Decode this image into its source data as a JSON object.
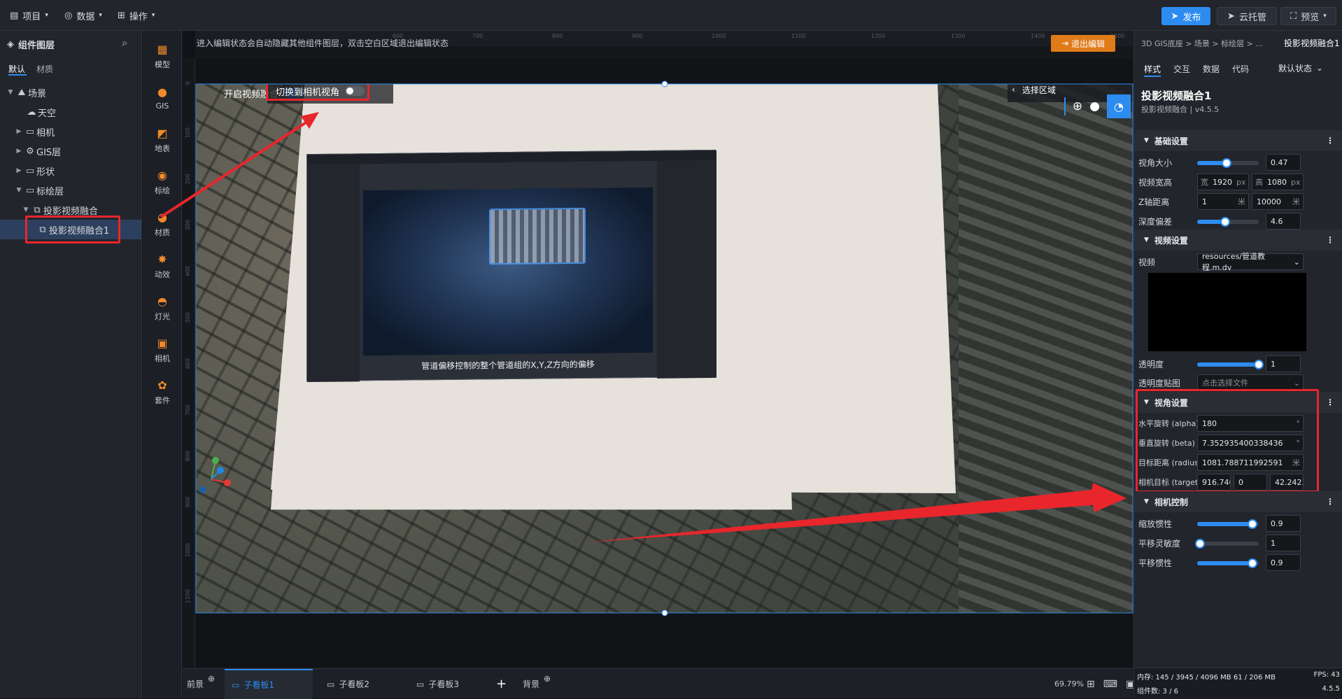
{
  "topbar": {
    "menus": [
      {
        "label": "项目"
      },
      {
        "label": "数据"
      },
      {
        "label": "操作"
      }
    ],
    "publish_label": "发布",
    "cloud_label": "云托管",
    "preview_label": "预览"
  },
  "left_panel": {
    "title": "组件图层",
    "tabs": [
      "默认",
      "材质"
    ],
    "tree": [
      {
        "label": "场景"
      },
      {
        "label": "天空"
      },
      {
        "label": "相机"
      },
      {
        "label": "GIS层"
      },
      {
        "label": "形状"
      },
      {
        "label": "标绘层"
      },
      {
        "label": "投影视频融合"
      },
      {
        "label": "投影视频融合1"
      }
    ]
  },
  "tools": [
    {
      "label": "模型"
    },
    {
      "label": "GIS"
    },
    {
      "label": "地表"
    },
    {
      "label": "标绘"
    },
    {
      "label": "材质"
    },
    {
      "label": "动效"
    },
    {
      "label": "灯光"
    },
    {
      "label": "相机"
    },
    {
      "label": "套件"
    }
  ],
  "canvas": {
    "hint": "进入编辑状态会自动隐藏其他组件图层，双击空白区域退出编辑状态",
    "exit_edit_label": "退出编辑",
    "ruler_h": [
      "600",
      "700",
      "800",
      "900",
      "1000",
      "1100",
      "1200",
      "1300",
      "1400",
      "1500",
      "1600",
      "1700"
    ],
    "ruler_v": [
      "0",
      "100",
      "200",
      "300",
      "400",
      "500",
      "600",
      "700",
      "800",
      "900",
      "1000",
      "1100"
    ],
    "toggle_video_label": "开启视频融合",
    "toggle_camera_label": "切换到相机视角",
    "select_area_label": "选择区域",
    "video_caption": "管道偏移控制的整个管道组的X,Y,Z方向的偏移"
  },
  "right_panel": {
    "breadcrumb": "3D GIS底座 > 场景 > 标绘层 > ...",
    "component_title": "投影视频融合1",
    "tabs": [
      "样式",
      "交互",
      "数据",
      "代码"
    ],
    "state_label": "默认状态",
    "name": "投影视频融合1",
    "subname": "投影视频融合 | v4.5.5",
    "sections": {
      "basic": "基础设置",
      "video": "视频设置",
      "view": "视角设置",
      "camera": "相机控制"
    },
    "basic": {
      "fov_label": "视角大小",
      "fov_value": "0.47",
      "fov_level": 0.48,
      "size_label": "视频宽高",
      "width_prefix": "宽",
      "width": "1920",
      "height_prefix": "高",
      "height": "1080",
      "unit": "px",
      "z_label": "Z轴距离",
      "z_near": "1",
      "z_far": "10000",
      "z_unit": "米",
      "depth_label": "深度偏差",
      "depth_value": "4.6",
      "depth_level": 0.46
    },
    "video": {
      "video_label": "视频",
      "video_value": "resources/管道教程.m.dv",
      "opacity_label": "透明度",
      "opacity_value": "1",
      "opacity_level": 1.0,
      "opacity_map_label": "透明度贴图",
      "opacity_map_value": "点击选择文件"
    },
    "view": {
      "alpha_label": "水平旋转 (alpha)",
      "alpha_value": "180",
      "alpha_unit": "°",
      "beta_label": "垂直旋转 (beta)",
      "beta_value": "7.352935400338436",
      "beta_unit": "°",
      "radius_label": "目标距离 (radius)",
      "radius_value": "1081.788711992591",
      "radius_unit": "米",
      "target_label": "相机目标 (target)",
      "target_x": "916.74620",
      "target_y": "0",
      "target_z": "42.242345"
    },
    "camera": {
      "zoom_label": "缩放惯性",
      "zoom_value": "0.9",
      "zoom_level": 0.9,
      "pan_sens_label": "平移灵敏度",
      "pan_sens_value": "1",
      "pan_sens_level": 0.05,
      "pan_inertia_label": "平移惯性",
      "pan_inertia_value": "0.9",
      "pan_inertia_level": 0.9
    },
    "footer": {
      "memory": "内存: 145 / 3945 / 4096 MB  61 / 206 MB",
      "fps": "FPS: 43",
      "count": "组件数: 3 / 6",
      "version": "4.5.5"
    }
  },
  "bottom": {
    "front_label": "前景",
    "tabs": [
      "子看板1",
      "子看板2",
      "子看板3"
    ],
    "add_label": "+",
    "back_label": "背景",
    "zoom": "69.79%"
  },
  "colors": {
    "accent": "#2d8cf0",
    "highlight": "#e8262c",
    "orange": "#f08a2a"
  }
}
